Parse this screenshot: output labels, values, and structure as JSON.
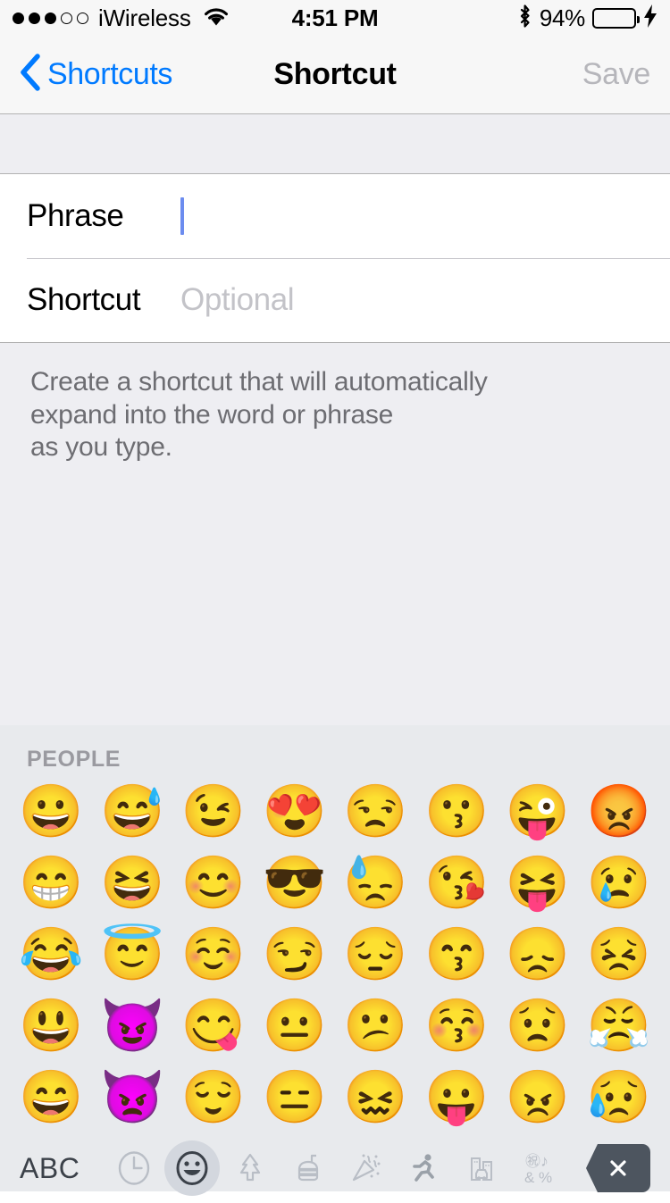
{
  "status_bar": {
    "signal_dots": [
      "filled",
      "filled",
      "filled",
      "empty",
      "empty"
    ],
    "carrier": "iWireless",
    "wifi_icon": "wifi-icon",
    "time": "4:51 PM",
    "bluetooth_icon": "bluetooth-icon",
    "battery_percent": "94%",
    "battery_level": 0.9,
    "battery_color": "#4cd964",
    "charging_icon": "lightning-bolt-icon"
  },
  "nav_bar": {
    "back_icon": "chevron-left-icon",
    "back_label": "Shortcuts",
    "title": "Shortcut",
    "save_label": "Save",
    "accent_color": "#007aff",
    "disabled_color": "#b6b6bb"
  },
  "form": {
    "rows": [
      {
        "label": "Phrase",
        "value": "",
        "placeholder": "",
        "focused": true
      },
      {
        "label": "Shortcut",
        "value": "",
        "placeholder": "Optional",
        "focused": false
      }
    ],
    "caret_color": "#6c8cef",
    "footer_note": "Create a shortcut that will automatically\n expand into the word or phrase\n as you type."
  },
  "keyboard": {
    "section_title": "PEOPLE",
    "emoji_rows": [
      [
        "😀",
        "😅",
        "😉",
        "😍",
        "😒",
        "😗",
        "😜",
        "😡"
      ],
      [
        "😁",
        "😆",
        "😊",
        "😎",
        "😓",
        "😘",
        "😝",
        "😢"
      ],
      [
        "😂",
        "😇",
        "☺️",
        "😏",
        "😔",
        "😙",
        "😞",
        "😣"
      ],
      [
        "😃",
        "😈",
        "😋",
        "😐",
        "😕",
        "😚",
        "😟",
        "😤"
      ],
      [
        "😄",
        "👿",
        "😌",
        "😑",
        "😖",
        "😛",
        "😠",
        "😥"
      ]
    ],
    "abc_label": "ABC",
    "tabs": [
      {
        "name": "recents-tab",
        "icon": "clock-icon",
        "selected": false
      },
      {
        "name": "smileys-tab",
        "icon": "smiley-icon",
        "selected": true
      },
      {
        "name": "nature-tab",
        "icon": "tree-icon",
        "selected": false
      },
      {
        "name": "food-tab",
        "icon": "burger-icon",
        "selected": false
      },
      {
        "name": "celebration-tab",
        "icon": "party-popper-icon",
        "selected": false
      },
      {
        "name": "activity-tab",
        "icon": "runner-icon",
        "selected": false
      },
      {
        "name": "travel-tab",
        "icon": "building-car-icon",
        "selected": false
      },
      {
        "name": "symbols-tab",
        "icon": "symbols-icon",
        "selected": false
      }
    ],
    "delete_icon": "delete-x-icon",
    "delete_key_color": "#4d555f",
    "background_color": "#e8eaed"
  }
}
